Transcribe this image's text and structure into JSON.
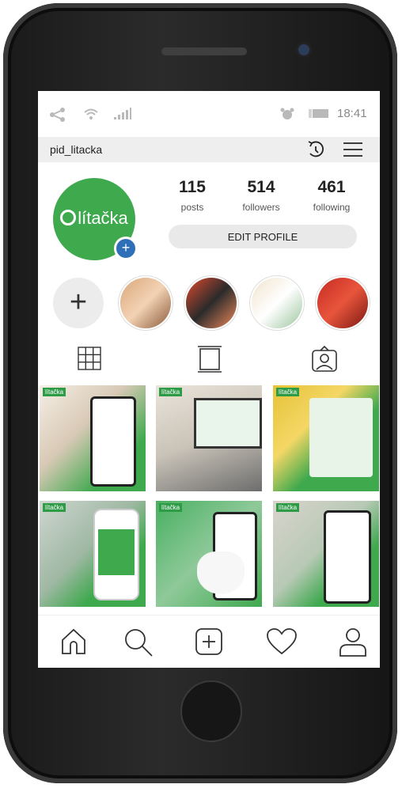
{
  "status_bar": {
    "time": "18:41"
  },
  "header": {
    "username": "pid_litacka"
  },
  "profile": {
    "logo_text": "lítačka",
    "stats": [
      {
        "value": "115",
        "label": "posts"
      },
      {
        "value": "514",
        "label": "followers"
      },
      {
        "value": "461",
        "label": "following"
      }
    ],
    "edit_button": "EDIT PROFILE"
  },
  "grid_brand": "lítačka",
  "icons": {
    "status": [
      "share-icon",
      "wifi-icon",
      "signal-icon",
      "alarm-icon",
      "battery-icon"
    ],
    "header": [
      "history-icon",
      "menu-icon"
    ],
    "tabs": [
      "grid-icon",
      "feed-icon",
      "tagged-icon"
    ],
    "nav": [
      "home-icon",
      "search-icon",
      "add-post-icon",
      "heart-icon",
      "profile-icon"
    ]
  },
  "colors": {
    "brand_green": "#3fa94e",
    "badge_blue": "#2f6fb8"
  }
}
